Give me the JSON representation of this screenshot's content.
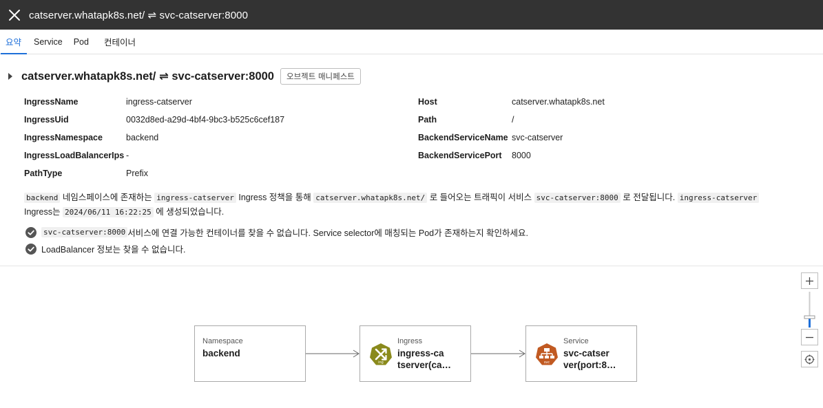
{
  "header": {
    "title": "catserver.whatapk8s.net/ ⇌ svc-catserver:8000",
    "close_icon": "close-icon"
  },
  "tabs": [
    {
      "label": "요약",
      "active": true
    },
    {
      "label": "Service",
      "active": false
    },
    {
      "label": "Pod",
      "active": false
    },
    {
      "label": "컨테이너",
      "active": false
    }
  ],
  "summary": {
    "title": "catserver.whatapk8s.net/ ⇌ svc-catserver:8000",
    "manifest_button": "오브젝트 매니페스트"
  },
  "fields_left": [
    {
      "key": "IngressName",
      "value": "ingress-catserver"
    },
    {
      "key": "IngressUid",
      "value": "0032d8ed-a29d-4bf4-9bc3-b525c6cef187"
    },
    {
      "key": "IngressNamespace",
      "value": "backend"
    },
    {
      "key": "IngressLoadBalancerIps",
      "value": "-"
    },
    {
      "key": "PathType",
      "value": "Prefix"
    }
  ],
  "fields_right": [
    {
      "key": "Host",
      "value": "catserver.whatapk8s.net"
    },
    {
      "key": "Path",
      "value": "/"
    },
    {
      "key": "BackendServiceName",
      "value": "svc-catserver"
    },
    {
      "key": "BackendServicePort",
      "value": "8000"
    }
  ],
  "description": {
    "c1": "backend",
    "t1": " 네임스페이스에 존재하는 ",
    "c2": "ingress-catserver",
    "t2": " Ingress 정책을 통해 ",
    "c3": "catserver.whatapk8s.net/",
    "t3": " 로 들어오는 트래픽이 서비스 ",
    "c4": "svc-catserver:8000",
    "t4": " 로 전달됩니다. ",
    "c5": "ingress-catserver",
    "t5": "Ingress는 ",
    "c6": "2024/06/11 16:22:25",
    "t6": " 에 생성되었습니다."
  },
  "checks": {
    "first_code": "svc-catserver:8000",
    "first_text": " 서비스에 연결 가능한 컨테이너를 찾을 수 없습니다. Service selector에 매칭되는 Pod가 존재하는지 확인하세요.",
    "second_text": "LoadBalancer 정보는 찾을 수 없습니다."
  },
  "graph": {
    "nodes": [
      {
        "type": "Namespace",
        "name": "backend",
        "icon": ""
      },
      {
        "type": "Ingress",
        "name_line1": "ingress-ca",
        "name_line2": "tserver(ca…",
        "icon": "ingress-icon",
        "icon_label": "ing"
      },
      {
        "type": "Service",
        "name_line1": "svc-catser",
        "name_line2": "ver(port:8…",
        "icon": "service-icon",
        "icon_label": "svc"
      }
    ],
    "colors": {
      "ingress": "#8a8a1c",
      "service": "#c15a22",
      "accent": "#1e6fd9"
    }
  },
  "zoom_controls": {
    "zoom_in": "+",
    "zoom_out": "−",
    "level_fraction": 0.25
  }
}
